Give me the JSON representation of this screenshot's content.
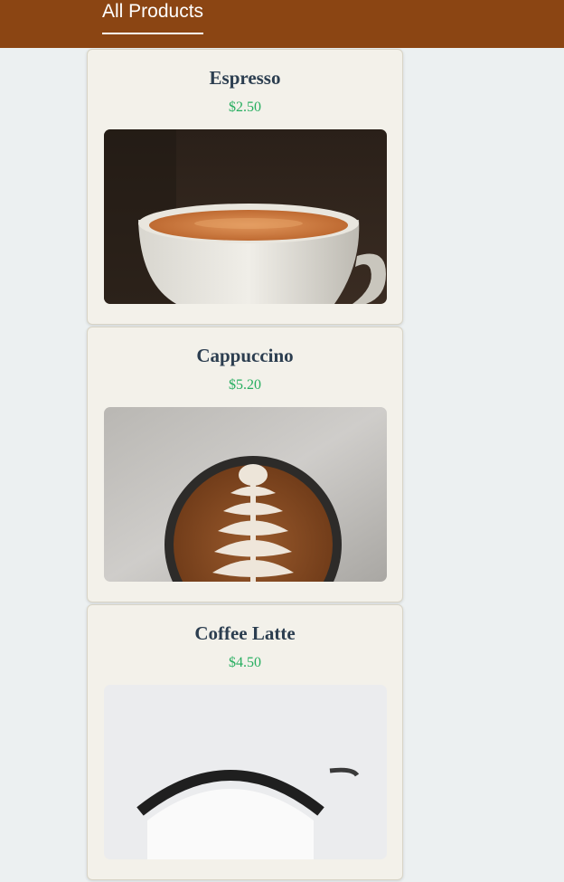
{
  "header": {
    "tab_label": "All Products",
    "background": "#8b4513"
  },
  "products": [
    {
      "name": "Espresso",
      "price": "$2.50",
      "image": "espresso-cup-photo"
    },
    {
      "name": "Cappuccino",
      "price": "$5.20",
      "image": "cappuccino-latte-art-photo"
    },
    {
      "name": "Coffee Latte",
      "price": "$4.50",
      "image": "latte-cup-photo"
    }
  ],
  "colors": {
    "page_bg": "#ecf0f1",
    "card_bg": "#f3f1ea",
    "name_text": "#2c3e50",
    "price_text": "#27ae60"
  }
}
